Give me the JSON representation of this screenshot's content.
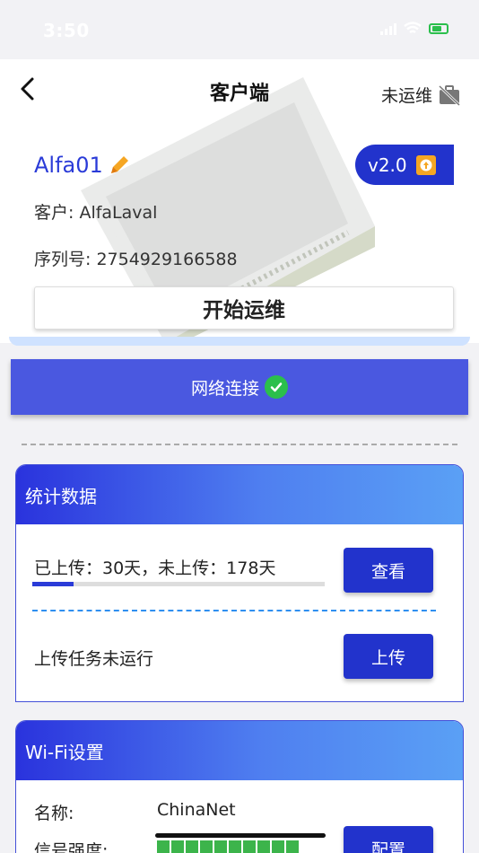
{
  "status_bar": {
    "time": "3:50"
  },
  "header": {
    "title": "客户端",
    "ops_status": "未运维",
    "device_name": "Alfa01",
    "version": "v2.0",
    "customer": "客户: AlfaLaval",
    "serial": "序列号: 2754929166588",
    "start_ops_label": "开始运维"
  },
  "network": {
    "label": "网络连接"
  },
  "stats": {
    "title": "统计数据",
    "upload_summary": "已上传：30天，未上传：178天",
    "upload_progress": 0.14,
    "view_label": "查看",
    "task_status": "上传任务未运行",
    "upload_label": "上传"
  },
  "wifi": {
    "title": "Wi-Fi设置",
    "name_label": "名称:",
    "name_value": "ChinaNet",
    "signal_label": "信号强度:",
    "signal_level": 10,
    "config_label": "配置"
  },
  "colors": {
    "accent": "#2233cc",
    "network_bar": "#4a58e0",
    "success": "#2bbf4c",
    "warning": "#f5a623"
  },
  "icons": [
    "back-arrow-icon",
    "briefcase-off-icon",
    "pencil-icon",
    "upgrade-icon",
    "check-circle-icon",
    "signal-icon",
    "wifi-icon",
    "battery-icon"
  ]
}
